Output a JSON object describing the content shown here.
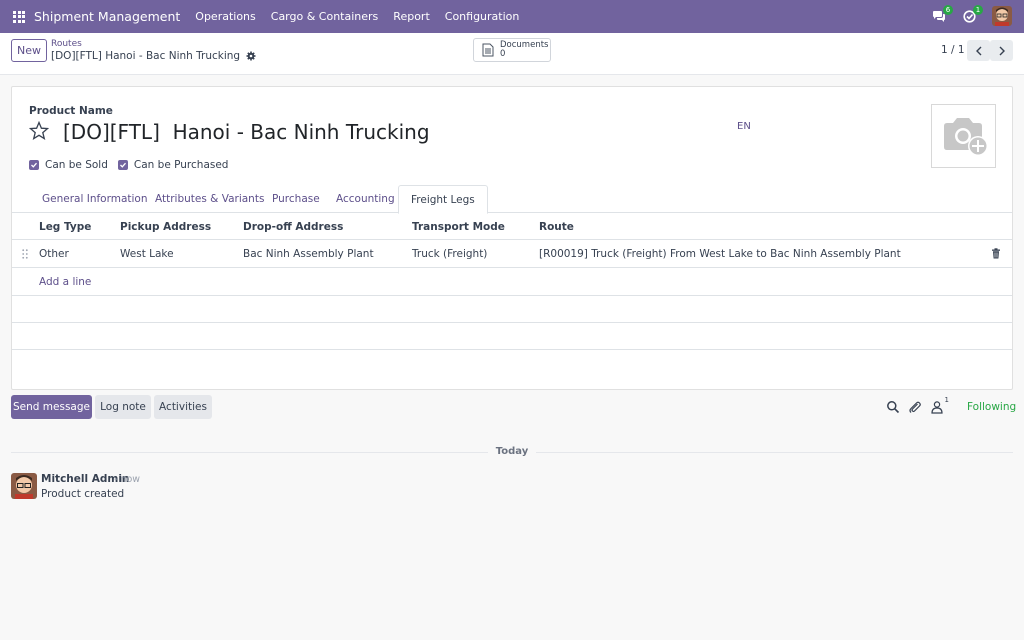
{
  "navbar": {
    "brand": "Shipment Management",
    "menu": [
      "Operations",
      "Cargo & Containers",
      "Report",
      "Configuration"
    ],
    "messages_badge": "6",
    "activities_badge": "1",
    "accent": "#71639e"
  },
  "control_panel": {
    "new_label": "New",
    "breadcrumb_parent": "Routes",
    "breadcrumb_current": "[DO][FTL] Hanoi - Bac Ninh Trucking",
    "documents_label": "Documents",
    "documents_count": "0",
    "pager": "1 / 1"
  },
  "form": {
    "field_label": "Product Name",
    "title": "[DO][FTL]  Hanoi - Bac Ninh Trucking",
    "lang": "EN",
    "can_be_sold": "Can be Sold",
    "can_be_purchased": "Can be Purchased",
    "tabs": [
      "General Information",
      "Attributes & Variants",
      "Purchase",
      "Accounting",
      "Freight Legs"
    ],
    "active_tab": "Freight Legs",
    "columns": [
      "Leg Type",
      "Pickup Address",
      "Drop-off Address",
      "Transport Mode",
      "Route"
    ],
    "rows": [
      {
        "leg_type": "Other",
        "pickup": "West Lake",
        "dropoff": "Bac Ninh Assembly Plant",
        "mode": "Truck (Freight)",
        "route": "[R00019] Truck (Freight) From West Lake to Bac Ninh Assembly Plant"
      }
    ],
    "add_line": "Add a line"
  },
  "chatter": {
    "send_message": "Send message",
    "log_note": "Log note",
    "activities": "Activities",
    "followers_count": "1",
    "following": "Following",
    "today": "Today",
    "message": {
      "author": "Mitchell Admin",
      "time": "- now",
      "body": "Product created"
    }
  }
}
